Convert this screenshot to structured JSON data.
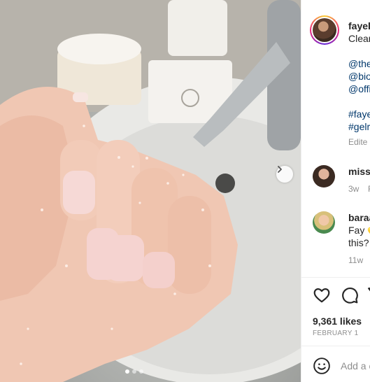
{
  "post": {
    "username": "fayel",
    "caption_first_line": "Clear",
    "mentions": [
      "@the",
      "@bio",
      "@offi"
    ],
    "hashtags": [
      "#faye",
      "#gelr"
    ],
    "edited_label": "Edite"
  },
  "comments": [
    {
      "username": "miss",
      "time": "3w",
      "reply_label": "R"
    },
    {
      "username": "baraa",
      "text_line1": "Fay",
      "text_line2": "this?",
      "time": "11w"
    }
  ],
  "stats": {
    "likes": "9,361 likes",
    "date": "FEBRUARY 1"
  },
  "add_comment": {
    "placeholder": "Add a c"
  },
  "carousel": {
    "slide_count": 3,
    "active_index": 0
  },
  "colors": {
    "link": "#00376b",
    "meta": "#8e8e8e",
    "text": "#262626"
  },
  "icons": [
    "chevron-right-icon",
    "heart-icon",
    "comment-icon",
    "share-icon",
    "emoji-icon"
  ]
}
